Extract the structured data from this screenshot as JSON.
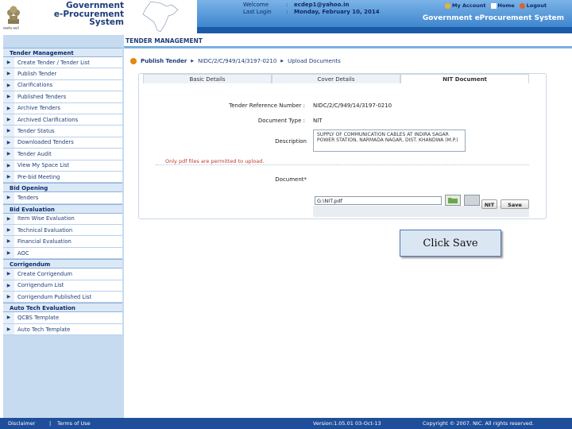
{
  "header": {
    "gov_lines": [
      "Government",
      "e-Procurement",
      "System"
    ],
    "emblem_caption": "सत्यमेव जयते",
    "welcome_label": "Welcome",
    "welcome_value": "ecdep1@yahoo.in",
    "lastlogin_label": "Last Login",
    "lastlogin_value": "Monday, February 10, 2014",
    "separator": ":",
    "links": {
      "account": "My Account",
      "home": "Home",
      "logout": "Logout"
    },
    "system_title": "Government eProcurement System"
  },
  "sidebar": {
    "groups": [
      {
        "title": "Tender Management",
        "items": [
          "Create Tender / Tender List",
          "Publish Tender",
          "Clarifications",
          "Published Tenders",
          "Archive Tenders",
          "Archived Clarifications",
          "Tender Status",
          "Downloaded Tenders",
          "Tender Audit",
          "View My Space List",
          "Pre-bid Meeting"
        ]
      },
      {
        "title": "Bid Opening",
        "items": [
          "Tenders"
        ]
      },
      {
        "title": "Bid Evaluation",
        "items": [
          "Item Wise Evaluation",
          "Technical Evaluation",
          "Financial Evaluation",
          "AOC"
        ]
      },
      {
        "title": "Corrigendum",
        "items": [
          "Create Corrigendum",
          "Corrigendum List",
          "Corrigendum Published List"
        ]
      },
      {
        "title": "Auto Tech Evaluation",
        "items": [
          "QCBS Template",
          "Auto Tech Template"
        ]
      }
    ]
  },
  "main": {
    "section_title": "TENDER MANAGEMENT",
    "breadcrumb": [
      "Publish Tender",
      "NIDC/2/C/949/14/3197-0210",
      "Upload Documents"
    ],
    "tabs": [
      "Basic Details",
      "Cover Details",
      "NIT Document"
    ],
    "form": {
      "ref_label": "Tender Reference Number :",
      "ref_value": "NIDC/2/C/949/14/3197-0210",
      "doctype_label": "Document Type :",
      "doctype_value": "NIT",
      "desc_label": "Description",
      "desc_value": "SUPPLY OF COMMUNICATION CABLES AT INDIRA SAGAR POWER STATION, NARMADA NAGAR, DIST. KHANDWA (M.P.)",
      "warning": "Only pdf files are permitted to upload.",
      "document_label": "Document*",
      "file_value": "G:\\NIT.pdf",
      "nit_button": "NIT",
      "save_button": "Save"
    },
    "callout": "Click Save"
  },
  "footer": {
    "disclaimer": "Disclaimer",
    "pipe": "|",
    "terms": "Terms of Use",
    "version": "Version:1.05.01 03-Oct-13",
    "copyright": "Copyright © 2007. NIC. All rights reserved."
  },
  "colors": {
    "brand": "#1f3d7a",
    "header_grad": "#3f86cf",
    "sidebar": "#c6dbf0",
    "footer": "#1f4f9a"
  }
}
